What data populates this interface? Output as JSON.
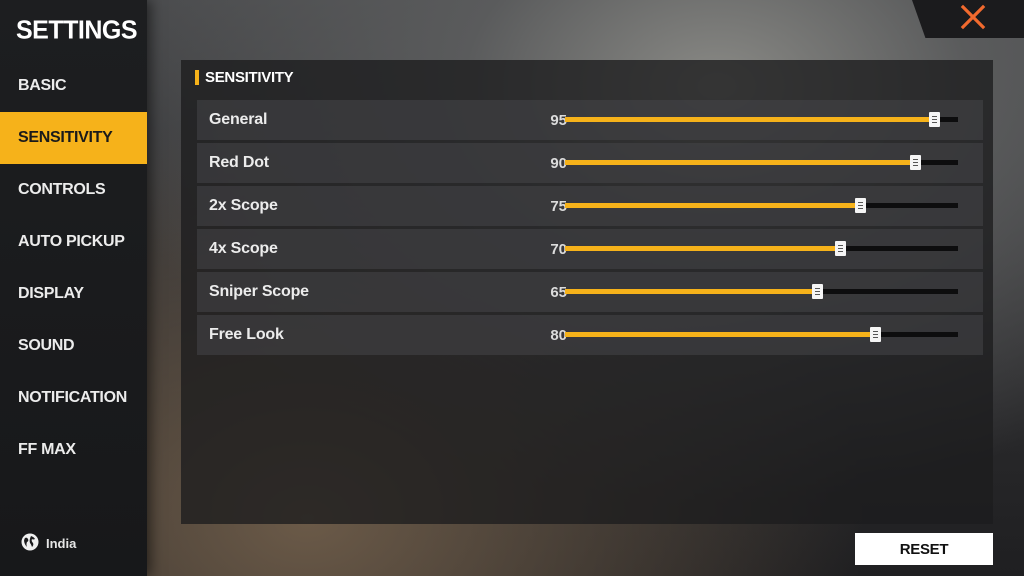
{
  "sidebar": {
    "title": "SETTINGS",
    "items": [
      {
        "label": "BASIC",
        "active": false
      },
      {
        "label": "SENSITIVITY",
        "active": true
      },
      {
        "label": "CONTROLS",
        "active": false
      },
      {
        "label": "AUTO PICKUP",
        "active": false
      },
      {
        "label": "DISPLAY",
        "active": false
      },
      {
        "label": "SOUND",
        "active": false
      },
      {
        "label": "NOTIFICATION",
        "active": false
      },
      {
        "label": "FF MAX",
        "active": false
      }
    ],
    "region": {
      "label": "India",
      "icon": "globe-icon"
    }
  },
  "close": {
    "icon": "close-icon",
    "color": "#f26a2e"
  },
  "panel": {
    "header": "SENSITIVITY",
    "rows": [
      {
        "label": "General",
        "value": "95",
        "level": 0.94
      },
      {
        "label": "Red Dot",
        "value": "90",
        "level": 0.89
      },
      {
        "label": "2x Scope",
        "value": "75",
        "level": 0.75
      },
      {
        "label": "4x Scope",
        "value": "70",
        "level": 0.7
      },
      {
        "label": "Sniper Scope",
        "value": "65",
        "level": 0.64
      },
      {
        "label": "Free Look",
        "value": "80",
        "level": 0.79
      }
    ]
  },
  "reset_label": "RESET",
  "colors": {
    "accent": "#f6b21a",
    "close": "#f26a2e"
  }
}
